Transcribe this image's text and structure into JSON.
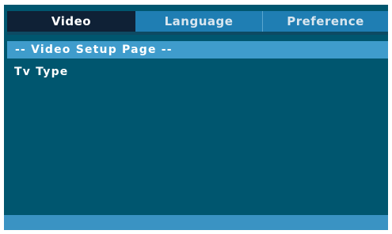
{
  "tabs": [
    {
      "label": "Video",
      "active": true
    },
    {
      "label": "Language",
      "active": false
    },
    {
      "label": "Preference",
      "active": false
    }
  ],
  "page": {
    "header": "-- Video Setup Page --"
  },
  "settings": [
    {
      "label": "Tv Type"
    }
  ],
  "colors": {
    "background": "#00566f",
    "active_tab": "#0f2136",
    "inactive_tab": "#1f7eb3",
    "header_bar": "#3f9ccc",
    "footer_bar": "#3a93c3"
  }
}
